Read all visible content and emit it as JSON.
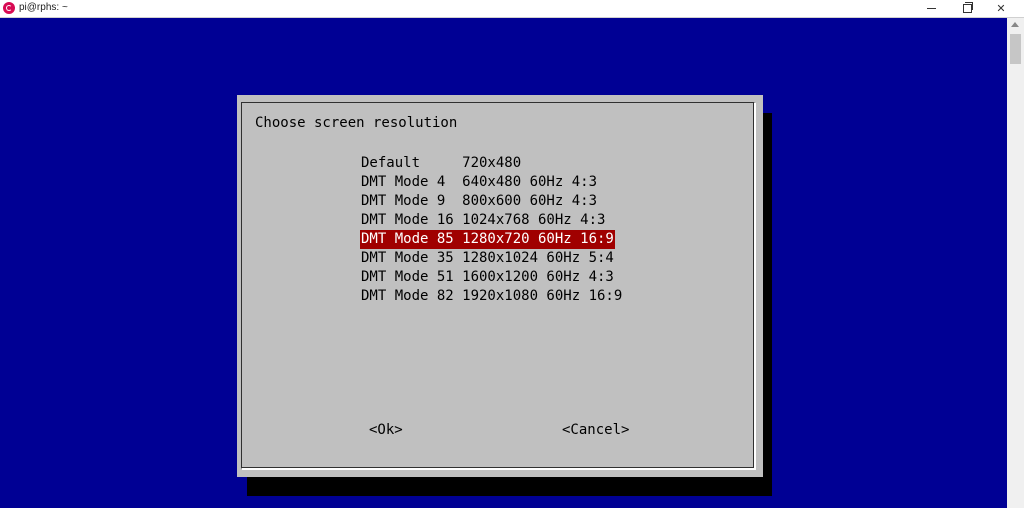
{
  "window": {
    "title": "pi@rphs: ~",
    "minimize_icon": "minimize-icon",
    "maximize_icon": "restore-icon",
    "close_label": "✕"
  },
  "dialog": {
    "title": "Choose screen resolution",
    "options": [
      {
        "label": "Default     720x480",
        "selected": false
      },
      {
        "label": "DMT Mode 4  640x480 60Hz 4:3",
        "selected": false
      },
      {
        "label": "DMT Mode 9  800x600 60Hz 4:3",
        "selected": false
      },
      {
        "label": "DMT Mode 16 1024x768 60Hz 4:3",
        "selected": false
      },
      {
        "label": "DMT Mode 85 1280x720 60Hz 16:9",
        "selected": true
      },
      {
        "label": "DMT Mode 35 1280x1024 60Hz 5:4",
        "selected": false
      },
      {
        "label": "DMT Mode 51 1600x1200 60Hz 4:3",
        "selected": false
      },
      {
        "label": "DMT Mode 82 1920x1080 60Hz 16:9",
        "selected": false
      }
    ],
    "ok_label": "<Ok>",
    "cancel_label": "<Cancel>"
  },
  "colors": {
    "terminal_bg": "#000094",
    "dialog_bg": "#c0c0c0",
    "selected_bg": "#a00000",
    "selected_fg": "#ffffff"
  }
}
